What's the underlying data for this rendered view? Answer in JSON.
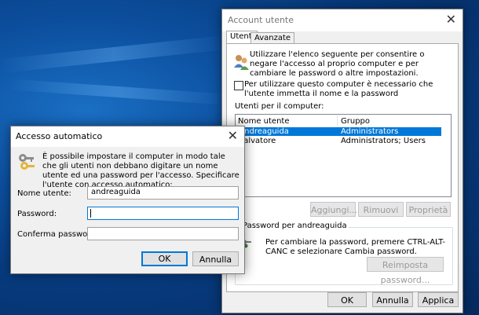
{
  "account": {
    "title": "Account utente",
    "tabs": [
      "Utenti",
      "Avanzate"
    ],
    "intro": "Utilizzare l'elenco seguente per consentire o negare l'accesso al proprio computer e per cambiare le password o altre impostazioni.",
    "checkbox_label": "Per utilizzare questo computer è necessario che l'utente immetta il nome e la password",
    "users_label": "Utenti per il computer:",
    "columns": [
      "Nome utente",
      "Gruppo"
    ],
    "rows": [
      {
        "name": "andreaguida",
        "group": "Administrators",
        "selected": true
      },
      {
        "name": "salvatore",
        "group": "Administrators; Users",
        "selected": false
      }
    ],
    "buttons": {
      "add": "Aggiungi...",
      "remove": "Rimuovi",
      "props": "Proprietà"
    },
    "password_group": "Password per andreaguida",
    "password_text": "Per cambiare la password, premere CTRL-ALT-CANC e selezionare Cambia password.",
    "reset_password": "Reimposta password...",
    "footer": {
      "ok": "OK",
      "cancel": "Annulla",
      "apply": "Applica"
    }
  },
  "auto": {
    "title": "Accesso automatico",
    "intro": "È possibile impostare il computer in modo tale che gli utenti non debbano digitare un nome utente ed una password per l'accesso. Specificare l'utente con accesso automatico:",
    "username_label": "Nome utente:",
    "username_value": "andreaguida",
    "password_label": "Password:",
    "password_value": "",
    "confirm_label": "Conferma password:",
    "confirm_value": "",
    "ok": "OK",
    "cancel": "Annulla"
  },
  "colors": {
    "selection": "#0078d7",
    "desktop": "#0c4f9e"
  }
}
